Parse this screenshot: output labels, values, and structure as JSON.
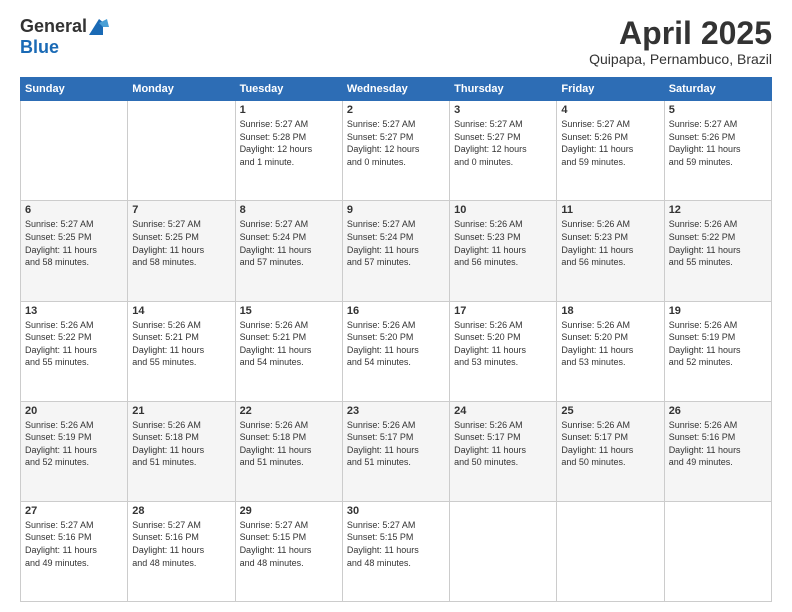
{
  "logo": {
    "general": "General",
    "blue": "Blue"
  },
  "header": {
    "month": "April 2025",
    "location": "Quipapa, Pernambuco, Brazil"
  },
  "weekdays": [
    "Sunday",
    "Monday",
    "Tuesday",
    "Wednesday",
    "Thursday",
    "Friday",
    "Saturday"
  ],
  "weeks": [
    [
      {
        "day": "",
        "info": ""
      },
      {
        "day": "",
        "info": ""
      },
      {
        "day": "1",
        "info": "Sunrise: 5:27 AM\nSunset: 5:28 PM\nDaylight: 12 hours\nand 1 minute."
      },
      {
        "day": "2",
        "info": "Sunrise: 5:27 AM\nSunset: 5:27 PM\nDaylight: 12 hours\nand 0 minutes."
      },
      {
        "day": "3",
        "info": "Sunrise: 5:27 AM\nSunset: 5:27 PM\nDaylight: 12 hours\nand 0 minutes."
      },
      {
        "day": "4",
        "info": "Sunrise: 5:27 AM\nSunset: 5:26 PM\nDaylight: 11 hours\nand 59 minutes."
      },
      {
        "day": "5",
        "info": "Sunrise: 5:27 AM\nSunset: 5:26 PM\nDaylight: 11 hours\nand 59 minutes."
      }
    ],
    [
      {
        "day": "6",
        "info": "Sunrise: 5:27 AM\nSunset: 5:25 PM\nDaylight: 11 hours\nand 58 minutes."
      },
      {
        "day": "7",
        "info": "Sunrise: 5:27 AM\nSunset: 5:25 PM\nDaylight: 11 hours\nand 58 minutes."
      },
      {
        "day": "8",
        "info": "Sunrise: 5:27 AM\nSunset: 5:24 PM\nDaylight: 11 hours\nand 57 minutes."
      },
      {
        "day": "9",
        "info": "Sunrise: 5:27 AM\nSunset: 5:24 PM\nDaylight: 11 hours\nand 57 minutes."
      },
      {
        "day": "10",
        "info": "Sunrise: 5:26 AM\nSunset: 5:23 PM\nDaylight: 11 hours\nand 56 minutes."
      },
      {
        "day": "11",
        "info": "Sunrise: 5:26 AM\nSunset: 5:23 PM\nDaylight: 11 hours\nand 56 minutes."
      },
      {
        "day": "12",
        "info": "Sunrise: 5:26 AM\nSunset: 5:22 PM\nDaylight: 11 hours\nand 55 minutes."
      }
    ],
    [
      {
        "day": "13",
        "info": "Sunrise: 5:26 AM\nSunset: 5:22 PM\nDaylight: 11 hours\nand 55 minutes."
      },
      {
        "day": "14",
        "info": "Sunrise: 5:26 AM\nSunset: 5:21 PM\nDaylight: 11 hours\nand 55 minutes."
      },
      {
        "day": "15",
        "info": "Sunrise: 5:26 AM\nSunset: 5:21 PM\nDaylight: 11 hours\nand 54 minutes."
      },
      {
        "day": "16",
        "info": "Sunrise: 5:26 AM\nSunset: 5:20 PM\nDaylight: 11 hours\nand 54 minutes."
      },
      {
        "day": "17",
        "info": "Sunrise: 5:26 AM\nSunset: 5:20 PM\nDaylight: 11 hours\nand 53 minutes."
      },
      {
        "day": "18",
        "info": "Sunrise: 5:26 AM\nSunset: 5:20 PM\nDaylight: 11 hours\nand 53 minutes."
      },
      {
        "day": "19",
        "info": "Sunrise: 5:26 AM\nSunset: 5:19 PM\nDaylight: 11 hours\nand 52 minutes."
      }
    ],
    [
      {
        "day": "20",
        "info": "Sunrise: 5:26 AM\nSunset: 5:19 PM\nDaylight: 11 hours\nand 52 minutes."
      },
      {
        "day": "21",
        "info": "Sunrise: 5:26 AM\nSunset: 5:18 PM\nDaylight: 11 hours\nand 51 minutes."
      },
      {
        "day": "22",
        "info": "Sunrise: 5:26 AM\nSunset: 5:18 PM\nDaylight: 11 hours\nand 51 minutes."
      },
      {
        "day": "23",
        "info": "Sunrise: 5:26 AM\nSunset: 5:17 PM\nDaylight: 11 hours\nand 51 minutes."
      },
      {
        "day": "24",
        "info": "Sunrise: 5:26 AM\nSunset: 5:17 PM\nDaylight: 11 hours\nand 50 minutes."
      },
      {
        "day": "25",
        "info": "Sunrise: 5:26 AM\nSunset: 5:17 PM\nDaylight: 11 hours\nand 50 minutes."
      },
      {
        "day": "26",
        "info": "Sunrise: 5:26 AM\nSunset: 5:16 PM\nDaylight: 11 hours\nand 49 minutes."
      }
    ],
    [
      {
        "day": "27",
        "info": "Sunrise: 5:27 AM\nSunset: 5:16 PM\nDaylight: 11 hours\nand 49 minutes."
      },
      {
        "day": "28",
        "info": "Sunrise: 5:27 AM\nSunset: 5:16 PM\nDaylight: 11 hours\nand 48 minutes."
      },
      {
        "day": "29",
        "info": "Sunrise: 5:27 AM\nSunset: 5:15 PM\nDaylight: 11 hours\nand 48 minutes."
      },
      {
        "day": "30",
        "info": "Sunrise: 5:27 AM\nSunset: 5:15 PM\nDaylight: 11 hours\nand 48 minutes."
      },
      {
        "day": "",
        "info": ""
      },
      {
        "day": "",
        "info": ""
      },
      {
        "day": "",
        "info": ""
      }
    ]
  ]
}
